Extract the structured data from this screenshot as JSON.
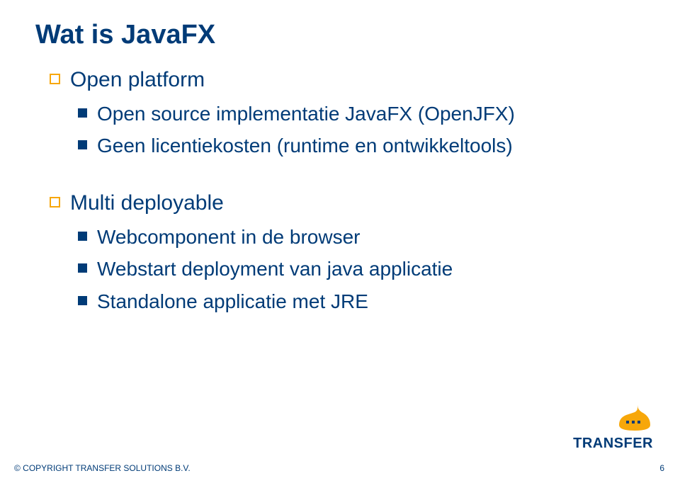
{
  "title": "Wat is JavaFX",
  "groups": [
    {
      "label": "Open platform",
      "items": [
        "Open source implementatie JavaFX (OpenJFX)",
        "Geen licentiekosten (runtime en ontwikkeltools)"
      ]
    },
    {
      "label": "Multi deployable",
      "items": [
        "Webcomponent in de browser",
        "Webstart deployment van java applicatie",
        "Standalone applicatie met JRE"
      ]
    }
  ],
  "logo_text": "TRANSFER",
  "footer": "© COPYRIGHT TRANSFER SOLUTIONS B.V.",
  "page_number": "6"
}
